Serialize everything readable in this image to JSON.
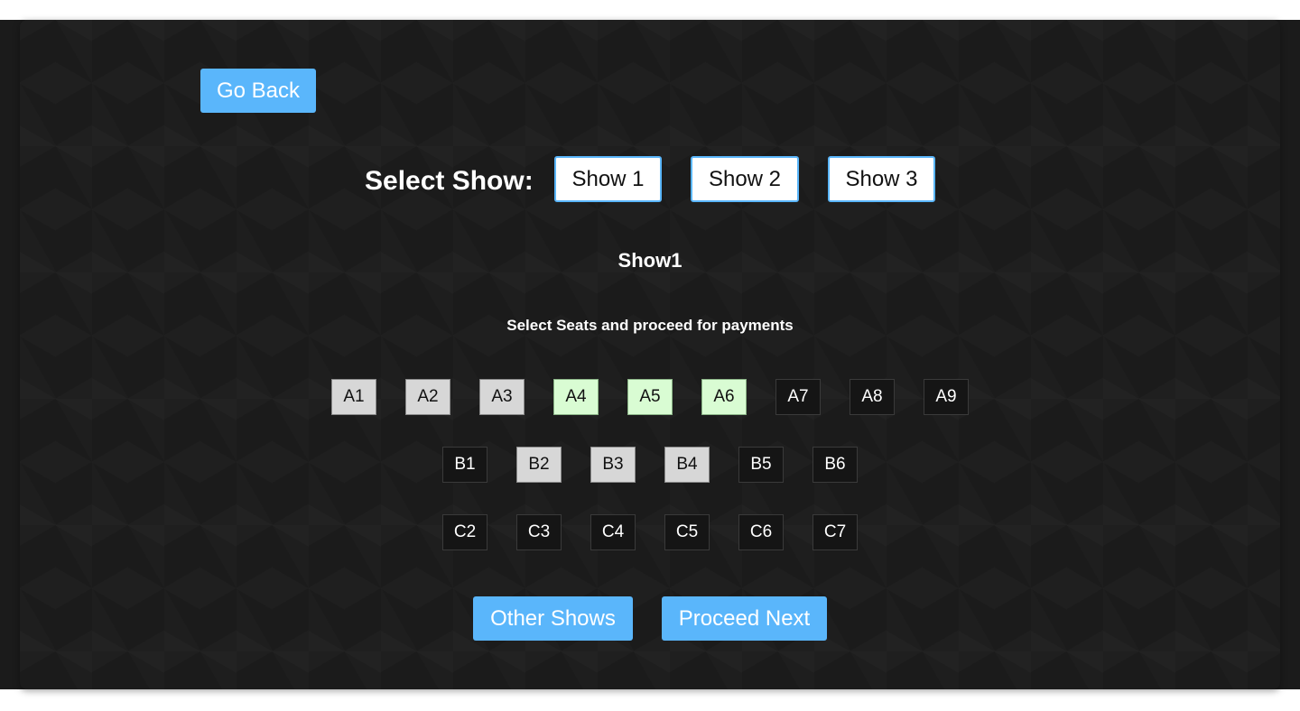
{
  "nav": {
    "go_back_label": "Go Back"
  },
  "show_selector": {
    "label": "Select Show:",
    "shows": [
      "Show 1",
      "Show 2",
      "Show 3"
    ]
  },
  "current_show": {
    "title": "Show1",
    "instructions": "Select Seats and proceed for payments"
  },
  "seats": {
    "row_a": [
      {
        "label": "A1",
        "state": "booked"
      },
      {
        "label": "A2",
        "state": "booked"
      },
      {
        "label": "A3",
        "state": "booked"
      },
      {
        "label": "A4",
        "state": "selected"
      },
      {
        "label": "A5",
        "state": "selected"
      },
      {
        "label": "A6",
        "state": "selected"
      },
      {
        "label": "A7",
        "state": "available"
      },
      {
        "label": "A8",
        "state": "available"
      },
      {
        "label": "A9",
        "state": "available"
      }
    ],
    "row_b": [
      {
        "label": "B1",
        "state": "available"
      },
      {
        "label": "B2",
        "state": "booked"
      },
      {
        "label": "B3",
        "state": "booked"
      },
      {
        "label": "B4",
        "state": "booked"
      },
      {
        "label": "B5",
        "state": "available"
      },
      {
        "label": "B6",
        "state": "available"
      }
    ],
    "row_c": [
      {
        "label": "C2",
        "state": "available"
      },
      {
        "label": "C3",
        "state": "available"
      },
      {
        "label": "C4",
        "state": "available"
      },
      {
        "label": "C5",
        "state": "available"
      },
      {
        "label": "C6",
        "state": "available"
      },
      {
        "label": "C7",
        "state": "available"
      }
    ]
  },
  "actions": {
    "other_shows_label": "Other Shows",
    "proceed_next_label": "Proceed Next"
  },
  "colors": {
    "accent": "#5ab6fb",
    "background": "#1b1b1b",
    "seat_booked": "#d7d7d7",
    "seat_selected": "#d9fcd3"
  }
}
